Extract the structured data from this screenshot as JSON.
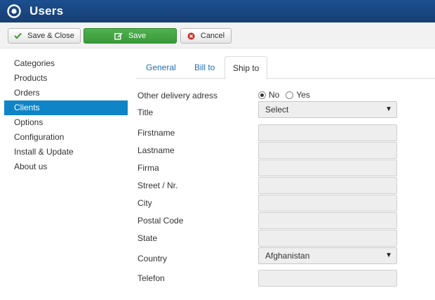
{
  "header": {
    "title": "Users",
    "logo_icon": "joomla-target-icon"
  },
  "toolbar": {
    "save_close_label": "Save & Close",
    "save_label": "Save",
    "cancel_label": "Cancel"
  },
  "sidebar": {
    "items": [
      {
        "label": "Categories",
        "active": false
      },
      {
        "label": "Products",
        "active": false
      },
      {
        "label": "Orders",
        "active": false
      },
      {
        "label": "Clients",
        "active": true
      },
      {
        "label": "Options",
        "active": false
      },
      {
        "label": "Configuration",
        "active": false
      },
      {
        "label": "Install & Update",
        "active": false
      },
      {
        "label": "About us",
        "active": false
      }
    ]
  },
  "tabs": {
    "items": [
      {
        "label": "General",
        "active": false
      },
      {
        "label": "Bill to",
        "active": false
      },
      {
        "label": "Ship to",
        "active": true
      }
    ]
  },
  "form": {
    "other_delivery": {
      "label": "Other delivery adress",
      "option_no": "No",
      "option_yes": "Yes",
      "selected": "No"
    },
    "title": {
      "label": "Title",
      "value": "Select"
    },
    "firstname": {
      "label": "Firstname",
      "value": ""
    },
    "lastname": {
      "label": "Lastname",
      "value": ""
    },
    "firma": {
      "label": "Firma",
      "value": ""
    },
    "street": {
      "label": "Street / Nr.",
      "value": ""
    },
    "city": {
      "label": "City",
      "value": ""
    },
    "postal_code": {
      "label": "Postal Code",
      "value": ""
    },
    "state": {
      "label": "State",
      "value": ""
    },
    "country": {
      "label": "Country",
      "value": "Afghanistan"
    },
    "telefon": {
      "label": "Telefon",
      "value": ""
    }
  },
  "colors": {
    "header_bg": "#173f73",
    "accent_blue": "#0f84c6",
    "save_green": "#3a9a3a",
    "cancel_red": "#c9302c"
  }
}
